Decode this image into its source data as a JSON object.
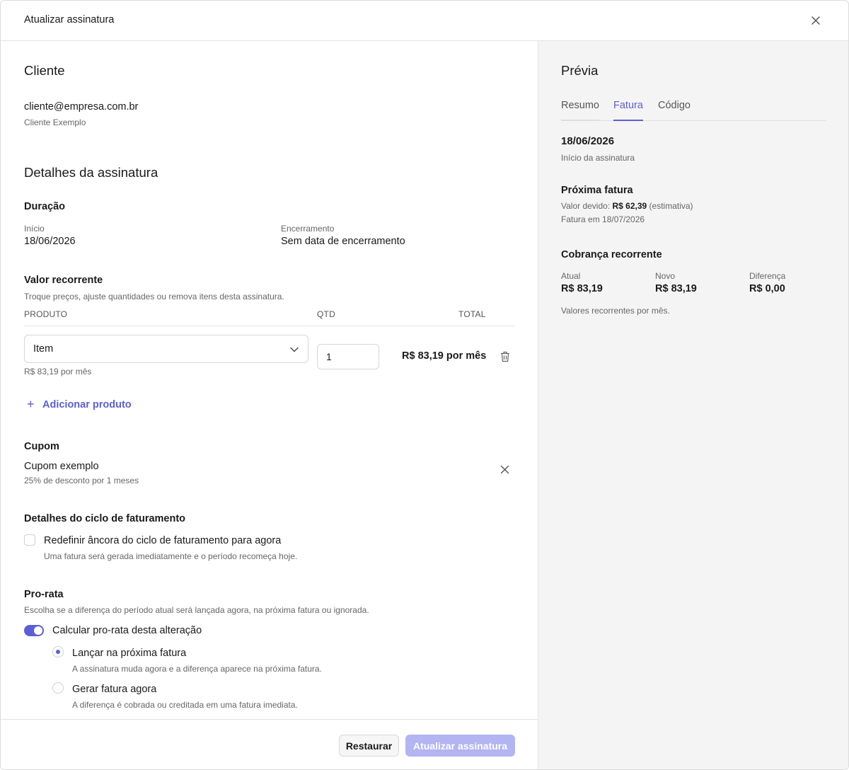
{
  "modal": {
    "title": "Atualizar assinatura"
  },
  "customer": {
    "heading": "Cliente",
    "email": "cliente@empresa.com.br",
    "name": "Cliente Exemplo"
  },
  "subscription": {
    "heading": "Detalhes da assinatura",
    "duration": {
      "heading": "Duração",
      "start_label": "Início",
      "start_value": "18/06/2026",
      "end_label": "Encerramento",
      "end_value": "Sem data de encerramento"
    },
    "recurring": {
      "heading": "Valor recorrente",
      "description": "Troque preços, ajuste quantidades ou remova itens desta assinatura.",
      "columns": {
        "product": "PRODUTO",
        "qty": "QTD",
        "total": "TOTAL"
      },
      "items": [
        {
          "product": "Item",
          "price_note": "R$ 83,19 por mês",
          "qty": "1",
          "total": "R$ 83,19 por mês"
        }
      ],
      "add_product": "Adicionar produto"
    },
    "coupon": {
      "heading": "Cupom",
      "name": "Cupom exemplo",
      "description": "25% de desconto por 1 meses"
    },
    "billing_cycle": {
      "heading": "Detalhes do ciclo de faturamento",
      "checkbox_label": "Redefinir âncora do ciclo de faturamento para agora",
      "checkbox_help": "Uma fatura será gerada imediatamente e o período recomeça hoje.",
      "checked": false
    },
    "proration": {
      "heading": "Pro-rata",
      "description": "Escolha se a diferença do período atual será lançada agora, na próxima fatura ou ignorada.",
      "toggle_label": "Calcular pro-rata desta alteração",
      "toggle_on": true,
      "options": [
        {
          "label": "Lançar na próxima fatura",
          "help": "A assinatura muda agora e a diferença aparece na próxima fatura.",
          "selected": true
        },
        {
          "label": "Gerar fatura agora",
          "help": "A diferença é cobrada ou creditada em uma fatura imediata.",
          "selected": false
        }
      ]
    }
  },
  "footer": {
    "restore_label": "Restaurar",
    "update_label": "Atualizar assinatura"
  },
  "preview": {
    "heading": "Prévia",
    "tabs": [
      {
        "label": "Resumo",
        "active": false
      },
      {
        "label": "Fatura",
        "active": true
      },
      {
        "label": "Código",
        "active": false
      }
    ],
    "start_date": "18/06/2026",
    "start_caption": "Início da assinatura",
    "next_invoice": {
      "heading": "Próxima fatura",
      "amount_prefix": "Valor devido:",
      "amount": "R$ 62,39",
      "amount_suffix": "(estimativa)",
      "date_text": "Fatura em 18/07/2026"
    },
    "recurring_charge": {
      "heading": "Cobrança recorrente",
      "current_label": "Atual",
      "current_value": "R$ 83,19",
      "new_label": "Novo",
      "new_value": "R$ 83,19",
      "diff_label": "Diferença",
      "diff_value": "R$ 0,00",
      "note": "Valores recorrentes por mês."
    }
  },
  "colors": {
    "accent": "#5c5fd6",
    "accent_disabled": "#b3b4f2",
    "preview_bg": "#f4f4f4"
  },
  "icons": {
    "close": "close-icon",
    "chevron": "chevron-down-icon",
    "trash": "trash-icon",
    "plus": "plus-icon",
    "remove_coupon": "close-icon"
  }
}
